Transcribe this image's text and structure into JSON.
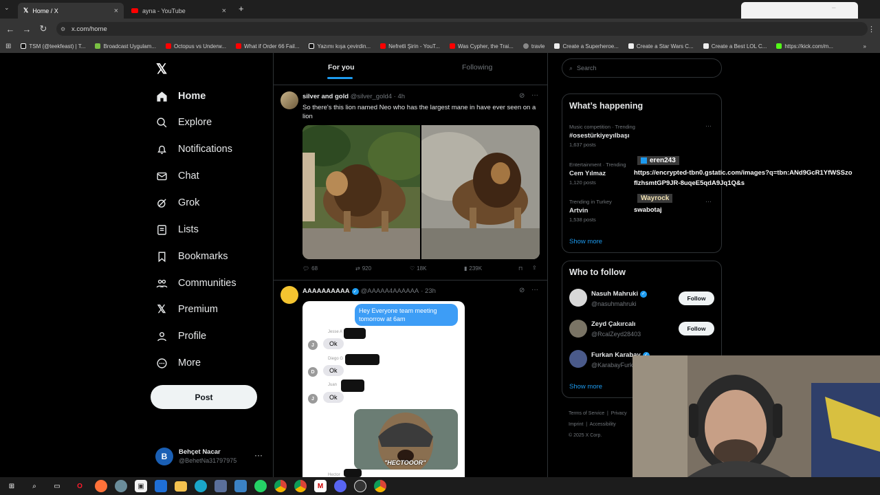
{
  "browser": {
    "tabs": [
      {
        "title": "Home / X"
      },
      {
        "title": "ayna - YouTube"
      }
    ],
    "url": "x.com/home",
    "bookmarks": [
      "TSM (@teekfeast) | T...",
      "Broadcast Uygulam...",
      "Octopus vs Underw...",
      "What if Order 66 Fail...",
      "Yazımı kışa çevirdin...",
      "Nefretli Şirin - YouT...",
      "Was Cypher, the Trai...",
      "travle",
      "Create a Superheroe...",
      "Create a Star Wars C...",
      "Create a Best LOL C...",
      "https://kick.com/m..."
    ]
  },
  "sidebar": {
    "items": [
      {
        "label": "Home"
      },
      {
        "label": "Explore"
      },
      {
        "label": "Notifications"
      },
      {
        "label": "Chat"
      },
      {
        "label": "Grok"
      },
      {
        "label": "Lists"
      },
      {
        "label": "Bookmarks"
      },
      {
        "label": "Communities"
      },
      {
        "label": "Premium"
      },
      {
        "label": "Profile"
      },
      {
        "label": "More"
      }
    ],
    "post_label": "Post",
    "account": {
      "name": "Behçet Nacar",
      "handle": "@BehetNa31797975",
      "initial": "B"
    }
  },
  "feed": {
    "tabs": [
      "For you",
      "Following"
    ],
    "tweet1": {
      "name": "silver and gold",
      "handle": "@silver_gold4",
      "time": "· 4h",
      "text": "So there's this lion named Neo who has the largest mane in have ever seen on a lion",
      "replies": "68",
      "retweets": "920",
      "likes": "18K",
      "views": "239K"
    },
    "tweet2": {
      "name": "AAAAAAAAAA",
      "handle": "@AAAAA4AAAAAA",
      "time": "· 23h",
      "bubble": "Hey Everyone team meeting tomorrow at 6am",
      "names": [
        "Jesse A",
        "Diego G",
        "Juan",
        "Hector"
      ],
      "initials": [
        "J",
        "D",
        "J"
      ],
      "reply": "Ok",
      "meme": "\"HECTOOOR\""
    }
  },
  "right": {
    "search_placeholder": "Search",
    "happening_title": "What’s happening",
    "trends": [
      {
        "category": "Music competition · Trending",
        "name": "#osestürkiyeyılbaşı",
        "posts": "1,637 posts"
      },
      {
        "category": "Entertainment · Trending",
        "name": "Cem Yılmaz",
        "posts": "1,120 posts"
      },
      {
        "category": "Trending in Turkey",
        "name": "Artvin",
        "posts": "1,538 posts"
      }
    ],
    "show_more": "Show more",
    "who_title": "Who to follow",
    "follow": [
      {
        "name": "Nasuh Mahruki",
        "handle": "@nasuhmahruki"
      },
      {
        "name": "Zeyd Çakırcalı",
        "handle": "@RcalZeyd28403"
      },
      {
        "name": "Furkan Karabay",
        "handle": "@KarabayFurk"
      }
    ],
    "follow_label": "Follow",
    "footer": [
      "Terms of Service",
      "Privacy",
      "Imprint",
      "Accessibility",
      "© 2025 X Corp."
    ]
  },
  "overlay": {
    "user1": "eren243",
    "url": "https://encrypted-tbn0.gstatic.com/images?q=tbn:ANd9GcR1YfWSSzofIzhsmtGP9JR-8uqeE5qdA9Jq1Q&s",
    "user2": "Wayrock",
    "message": "swabotaj"
  }
}
